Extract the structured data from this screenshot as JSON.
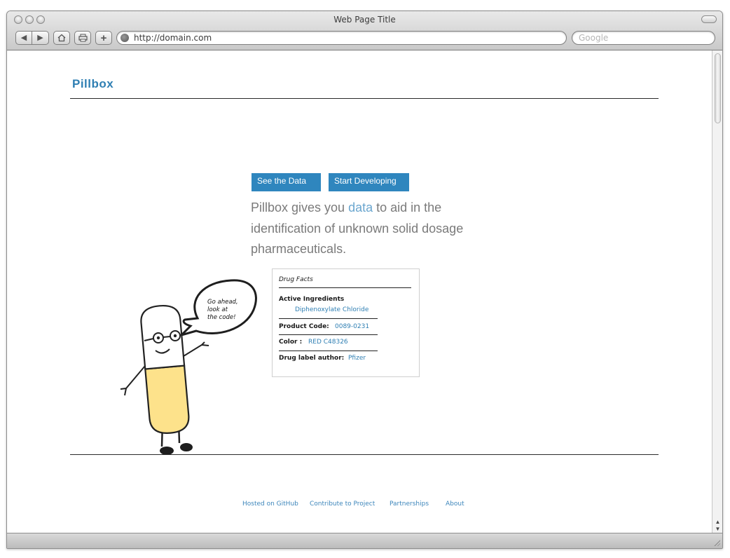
{
  "browser": {
    "window_title": "Web Page Title",
    "url": "http://domain.com",
    "search_placeholder": "Google"
  },
  "page": {
    "brand": "Pillbox",
    "buttons": {
      "see_data": "See the Data",
      "start_developing": "Start Developing"
    },
    "tagline": {
      "before": "Pillbox gives you ",
      "link": "data",
      "after": " to aid in the identification of unknown solid dosage pharmaceuticals."
    },
    "mascot": {
      "speech_line1": "Go ahead,",
      "speech_line2": "look at",
      "speech_line3": "the code!"
    },
    "drug_facts": {
      "title": "Drug Facts",
      "active_ingredients_label": "Active Ingredients",
      "active_ingredients_value": "Diphenoxylate Chloride",
      "product_code_label": "Product Code:",
      "product_code_value": "0089-0231",
      "color_label": "Color :",
      "color_value": "RED C48326",
      "author_label": "Drug label author:",
      "author_value": "Pfizer"
    },
    "footer": {
      "links": [
        "Hosted on GitHub",
        "Contribute to Project",
        "Partnerships",
        "About"
      ]
    }
  },
  "colors": {
    "brand_blue": "#2f7fb3",
    "button_blue": "#2f86be",
    "link_blue": "#6aa6cf",
    "pill_yellow": "#fde28b"
  }
}
